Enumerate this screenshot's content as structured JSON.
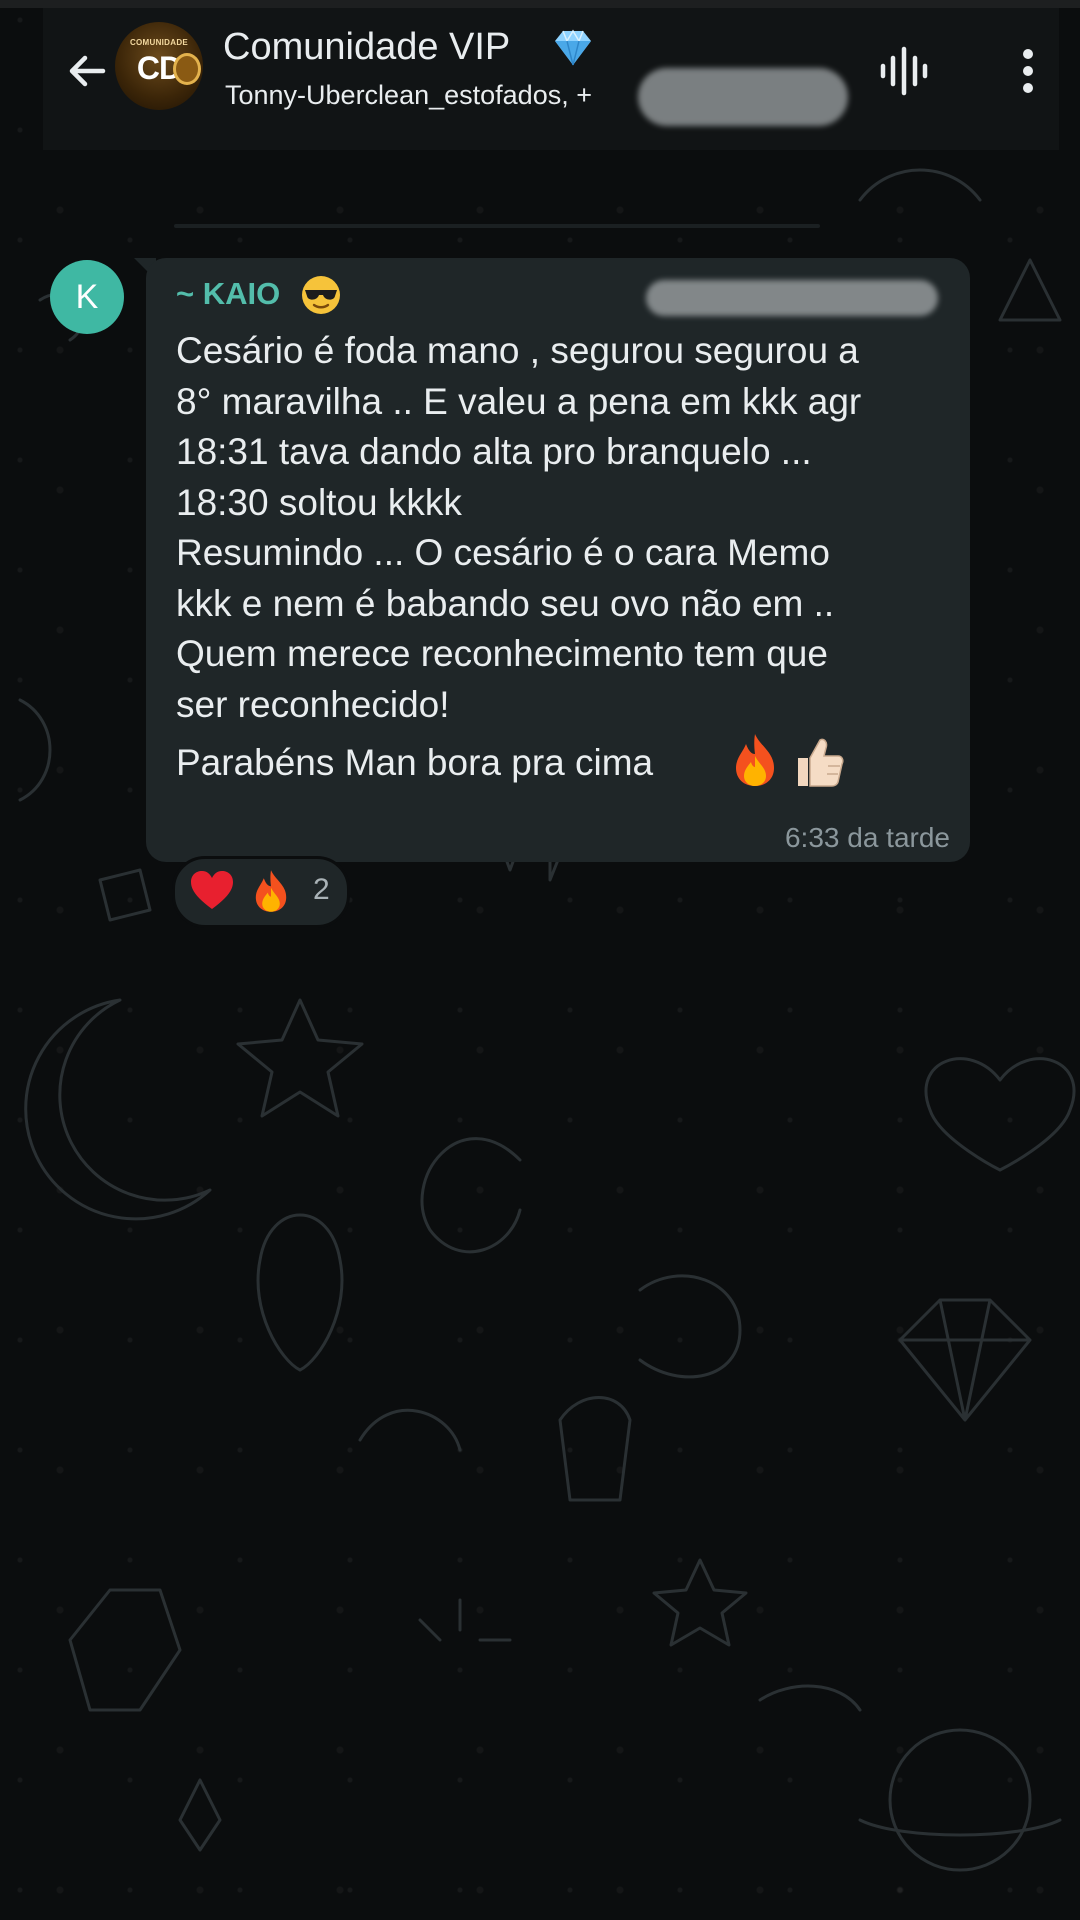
{
  "header": {
    "title": "Comunidade VIP",
    "subtitle": "Tonny-Uberclean_estofados, +",
    "avatar_top_text": "COMUNIDADE",
    "avatar_main_text": "CD"
  },
  "message": {
    "avatar_letter": "K",
    "sender_name": "~ KAIO",
    "body": "Cesário é foda mano , segurou segurou a\n8° maravilha .. E valeu a pena em kkk agr\n18:31 tava dando alta pro branquelo ...\n18:30 soltou kkkk\nResumindo ... O cesário é o cara Memo\nkkk e nem é babando seu ovo não em ..\nQuem merece reconhecimento tem que\nser reconhecido!",
    "closing_line": "Parabéns Man bora pra cima",
    "time": "6:33 da tarde"
  },
  "reactions": {
    "count": "2",
    "icons": [
      "heart-icon",
      "fire-icon"
    ]
  },
  "colors": {
    "background": "#0b0d0e",
    "header": "#111415",
    "bubble": "#1f2628",
    "sender_name": "#53bdab",
    "avatar": "#3fb8a3",
    "text": "#e9edef",
    "timestamp": "#8b979c"
  }
}
